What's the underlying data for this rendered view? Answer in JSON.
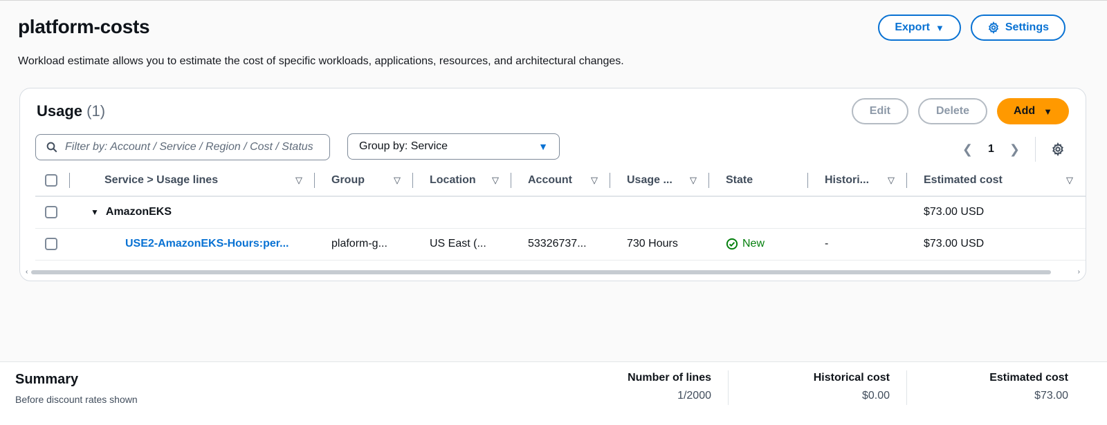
{
  "page": {
    "title": "platform-costs",
    "description": "Workload estimate allows you to estimate the cost of specific workloads, applications, resources, and architectural changes.",
    "export_label": "Export",
    "settings_label": "Settings"
  },
  "usage": {
    "title": "Usage",
    "count": "(1)",
    "edit_label": "Edit",
    "delete_label": "Delete",
    "add_label": "Add",
    "filter_placeholder": "Filter by: Account / Service / Region / Cost / Status",
    "group_by": "Group by: Service",
    "page_number": "1",
    "columns": {
      "service": "Service > Usage lines",
      "group": "Group",
      "location": "Location",
      "account": "Account",
      "usage": "Usage ...",
      "state": "State",
      "historical": "Histori...",
      "estimated": "Estimated cost"
    },
    "group_row": {
      "name": "AmazonEKS",
      "estimated": "$73.00  USD"
    },
    "rows": [
      {
        "service": "USE2-AmazonEKS-Hours:per...",
        "group": "plaform-g...",
        "location": "US East (...",
        "account": "53326737...",
        "usage": "730 Hours",
        "state": "New",
        "historical": "-",
        "estimated": "$73.00  USD"
      }
    ]
  },
  "summary": {
    "title": "Summary",
    "subtitle": "Before discount rates shown",
    "lines_label": "Number of lines",
    "lines_value": "1/2000",
    "historical_label": "Historical cost",
    "historical_value": "$0.00",
    "estimated_label": "Estimated cost",
    "estimated_value": "$73.00"
  },
  "colors": {
    "accent": "#0972d3",
    "primary_button": "#ff9900",
    "success": "#037f0c"
  },
  "icons": [
    "gear-icon",
    "search-icon",
    "caret-down-icon",
    "chevron-left-icon",
    "chevron-right-icon",
    "check-circle-icon"
  ]
}
